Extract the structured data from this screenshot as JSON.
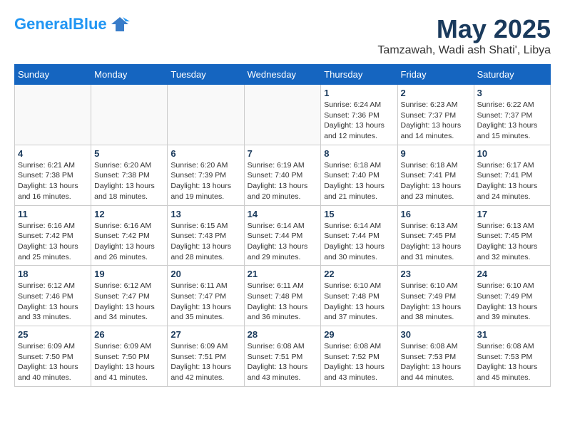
{
  "header": {
    "logo_general": "General",
    "logo_blue": "Blue",
    "month": "May 2025",
    "location": "Tamzawah, Wadi ash Shati', Libya"
  },
  "weekdays": [
    "Sunday",
    "Monday",
    "Tuesday",
    "Wednesday",
    "Thursday",
    "Friday",
    "Saturday"
  ],
  "weeks": [
    [
      {
        "day": "",
        "info": ""
      },
      {
        "day": "",
        "info": ""
      },
      {
        "day": "",
        "info": ""
      },
      {
        "day": "",
        "info": ""
      },
      {
        "day": "1",
        "info": "Sunrise: 6:24 AM\nSunset: 7:36 PM\nDaylight: 13 hours\nand 12 minutes."
      },
      {
        "day": "2",
        "info": "Sunrise: 6:23 AM\nSunset: 7:37 PM\nDaylight: 13 hours\nand 14 minutes."
      },
      {
        "day": "3",
        "info": "Sunrise: 6:22 AM\nSunset: 7:37 PM\nDaylight: 13 hours\nand 15 minutes."
      }
    ],
    [
      {
        "day": "4",
        "info": "Sunrise: 6:21 AM\nSunset: 7:38 PM\nDaylight: 13 hours\nand 16 minutes."
      },
      {
        "day": "5",
        "info": "Sunrise: 6:20 AM\nSunset: 7:38 PM\nDaylight: 13 hours\nand 18 minutes."
      },
      {
        "day": "6",
        "info": "Sunrise: 6:20 AM\nSunset: 7:39 PM\nDaylight: 13 hours\nand 19 minutes."
      },
      {
        "day": "7",
        "info": "Sunrise: 6:19 AM\nSunset: 7:40 PM\nDaylight: 13 hours\nand 20 minutes."
      },
      {
        "day": "8",
        "info": "Sunrise: 6:18 AM\nSunset: 7:40 PM\nDaylight: 13 hours\nand 21 minutes."
      },
      {
        "day": "9",
        "info": "Sunrise: 6:18 AM\nSunset: 7:41 PM\nDaylight: 13 hours\nand 23 minutes."
      },
      {
        "day": "10",
        "info": "Sunrise: 6:17 AM\nSunset: 7:41 PM\nDaylight: 13 hours\nand 24 minutes."
      }
    ],
    [
      {
        "day": "11",
        "info": "Sunrise: 6:16 AM\nSunset: 7:42 PM\nDaylight: 13 hours\nand 25 minutes."
      },
      {
        "day": "12",
        "info": "Sunrise: 6:16 AM\nSunset: 7:42 PM\nDaylight: 13 hours\nand 26 minutes."
      },
      {
        "day": "13",
        "info": "Sunrise: 6:15 AM\nSunset: 7:43 PM\nDaylight: 13 hours\nand 28 minutes."
      },
      {
        "day": "14",
        "info": "Sunrise: 6:14 AM\nSunset: 7:44 PM\nDaylight: 13 hours\nand 29 minutes."
      },
      {
        "day": "15",
        "info": "Sunrise: 6:14 AM\nSunset: 7:44 PM\nDaylight: 13 hours\nand 30 minutes."
      },
      {
        "day": "16",
        "info": "Sunrise: 6:13 AM\nSunset: 7:45 PM\nDaylight: 13 hours\nand 31 minutes."
      },
      {
        "day": "17",
        "info": "Sunrise: 6:13 AM\nSunset: 7:45 PM\nDaylight: 13 hours\nand 32 minutes."
      }
    ],
    [
      {
        "day": "18",
        "info": "Sunrise: 6:12 AM\nSunset: 7:46 PM\nDaylight: 13 hours\nand 33 minutes."
      },
      {
        "day": "19",
        "info": "Sunrise: 6:12 AM\nSunset: 7:47 PM\nDaylight: 13 hours\nand 34 minutes."
      },
      {
        "day": "20",
        "info": "Sunrise: 6:11 AM\nSunset: 7:47 PM\nDaylight: 13 hours\nand 35 minutes."
      },
      {
        "day": "21",
        "info": "Sunrise: 6:11 AM\nSunset: 7:48 PM\nDaylight: 13 hours\nand 36 minutes."
      },
      {
        "day": "22",
        "info": "Sunrise: 6:10 AM\nSunset: 7:48 PM\nDaylight: 13 hours\nand 37 minutes."
      },
      {
        "day": "23",
        "info": "Sunrise: 6:10 AM\nSunset: 7:49 PM\nDaylight: 13 hours\nand 38 minutes."
      },
      {
        "day": "24",
        "info": "Sunrise: 6:10 AM\nSunset: 7:49 PM\nDaylight: 13 hours\nand 39 minutes."
      }
    ],
    [
      {
        "day": "25",
        "info": "Sunrise: 6:09 AM\nSunset: 7:50 PM\nDaylight: 13 hours\nand 40 minutes."
      },
      {
        "day": "26",
        "info": "Sunrise: 6:09 AM\nSunset: 7:50 PM\nDaylight: 13 hours\nand 41 minutes."
      },
      {
        "day": "27",
        "info": "Sunrise: 6:09 AM\nSunset: 7:51 PM\nDaylight: 13 hours\nand 42 minutes."
      },
      {
        "day": "28",
        "info": "Sunrise: 6:08 AM\nSunset: 7:51 PM\nDaylight: 13 hours\nand 43 minutes."
      },
      {
        "day": "29",
        "info": "Sunrise: 6:08 AM\nSunset: 7:52 PM\nDaylight: 13 hours\nand 43 minutes."
      },
      {
        "day": "30",
        "info": "Sunrise: 6:08 AM\nSunset: 7:53 PM\nDaylight: 13 hours\nand 44 minutes."
      },
      {
        "day": "31",
        "info": "Sunrise: 6:08 AM\nSunset: 7:53 PM\nDaylight: 13 hours\nand 45 minutes."
      }
    ]
  ]
}
